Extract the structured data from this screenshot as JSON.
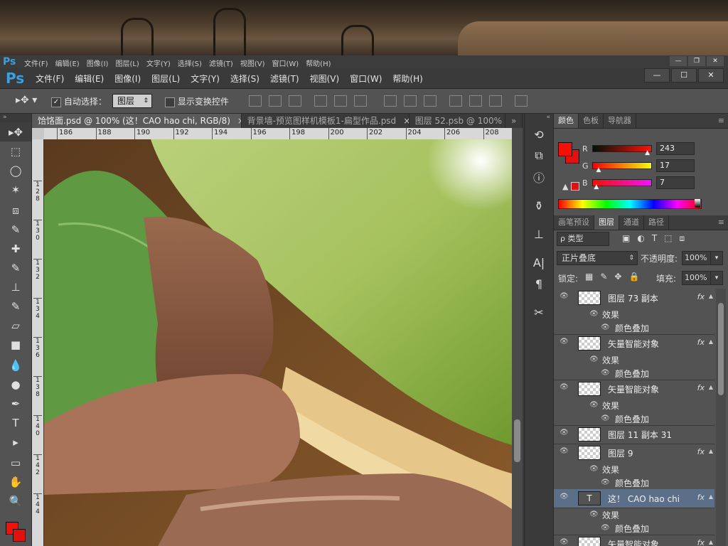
{
  "title_bar": {
    "logo": "Ps",
    "menus": [
      "文件(F)",
      "编辑(E)",
      "图像(I)",
      "图层(L)",
      "文字(Y)",
      "选择(S)",
      "滤镜(T)",
      "视图(V)",
      "窗口(W)",
      "帮助(H)"
    ],
    "window_buttons": [
      "—",
      "❐",
      "✕"
    ]
  },
  "menubar": {
    "logo": "Ps",
    "menus": [
      "文件(F)",
      "编辑(E)",
      "图像(I)",
      "图层(L)",
      "文字(Y)",
      "选择(S)",
      "滤镜(T)",
      "视图(V)",
      "窗口(W)",
      "帮助(H)"
    ],
    "window_buttons": [
      "—",
      "☐",
      "✕"
    ]
  },
  "options_bar": {
    "auto_select_label": "自动选择：",
    "auto_select_checked": true,
    "auto_select_value": "图层",
    "show_transform_label": "显示变换控件",
    "show_transform_checked": false
  },
  "tools": [
    "move-tool",
    "marquee-tool",
    "lasso-tool",
    "magic-wand-tool",
    "crop-tool",
    "eyedropper-tool",
    "healing-tool",
    "brush-tool",
    "stamp-tool",
    "history-brush-tool",
    "eraser-tool",
    "gradient-tool",
    "blur-tool",
    "dodge-tool",
    "pen-tool",
    "type-tool",
    "path-select-tool",
    "shape-tool",
    "hand-tool",
    "zoom-tool"
  ],
  "tool_glyphs": [
    "▸✥",
    "⬚",
    "◯",
    "✶",
    "⧈",
    "✎",
    "✚",
    "✎",
    "⊥",
    "✎",
    "▱",
    "■",
    "💧",
    "●",
    "✒",
    "T",
    "▸",
    "▭",
    "✋",
    "🔍"
  ],
  "doc_tabs": [
    {
      "label": "饸饹面.psd @ 100% (这！CAO hao chi, RGB/8)",
      "close": "×",
      "active": true
    },
    {
      "label": "背景墙-预览图样机模板1-扁型作品.psd",
      "close": "×",
      "active": false
    },
    {
      "label": "图层 52.psb @ 100%",
      "close": "",
      "active": false
    }
  ],
  "hruler_ticks": [
    "186",
    "188",
    "190",
    "192",
    "194",
    "196",
    "198",
    "200",
    "202",
    "204",
    "206",
    "208"
  ],
  "vruler_ticks": [
    "1\n2\n8",
    "1\n3\n0",
    "1\n3\n2",
    "1\n3\n4",
    "1\n3\n6",
    "1\n3\n8",
    "1\n4\n0",
    "1\n4\n2",
    "1\n4\n4"
  ],
  "color_panel": {
    "tabs": [
      "颜色",
      "色板",
      "导航器"
    ],
    "fg_color": "#f31107",
    "bg_color": "#e21010",
    "channels": [
      {
        "name": "R",
        "value": "243",
        "pct": 0.95
      },
      {
        "name": "G",
        "value": "17",
        "pct": 0.07
      },
      {
        "name": "B",
        "value": "7",
        "pct": 0.03
      }
    ]
  },
  "layers_panel": {
    "tabs": [
      "画笔预设",
      "图层",
      "通道",
      "路径"
    ],
    "filter_label": "ρ 类型",
    "blend_mode": "正片叠底",
    "opacity_label": "不透明度:",
    "opacity_value": "100%",
    "lock_label": "锁定:",
    "fill_label": "填充:",
    "fill_value": "100%",
    "layers": [
      {
        "name": "图层 73 副本",
        "fx": "fx",
        "effects": "效果",
        "effect_item": "颜色叠加",
        "selected": false
      },
      {
        "name": "矢量智能对象",
        "fx": "fx",
        "effects": "效果",
        "effect_item": "颜色叠加",
        "selected": false
      },
      {
        "name": "矢量智能对象",
        "fx": "fx",
        "effects": "效果",
        "effect_item": "颜色叠加",
        "selected": false
      },
      {
        "name": "图层 11 副本 31",
        "fx": "",
        "effects": "",
        "effect_item": "",
        "selected": false
      },
      {
        "name": "图层 9",
        "fx": "fx",
        "effects": "效果",
        "effect_item": "颜色叠加",
        "selected": false
      },
      {
        "name": "这！ CAO hao chi",
        "fx": "fx",
        "effects": "效果",
        "effect_item": "颜色叠加",
        "selected": true
      },
      {
        "name": "矢量智能对象",
        "fx": "fx",
        "effects": "",
        "effect_item": "",
        "selected": false
      }
    ]
  },
  "accent_color": "#3aa0e0"
}
